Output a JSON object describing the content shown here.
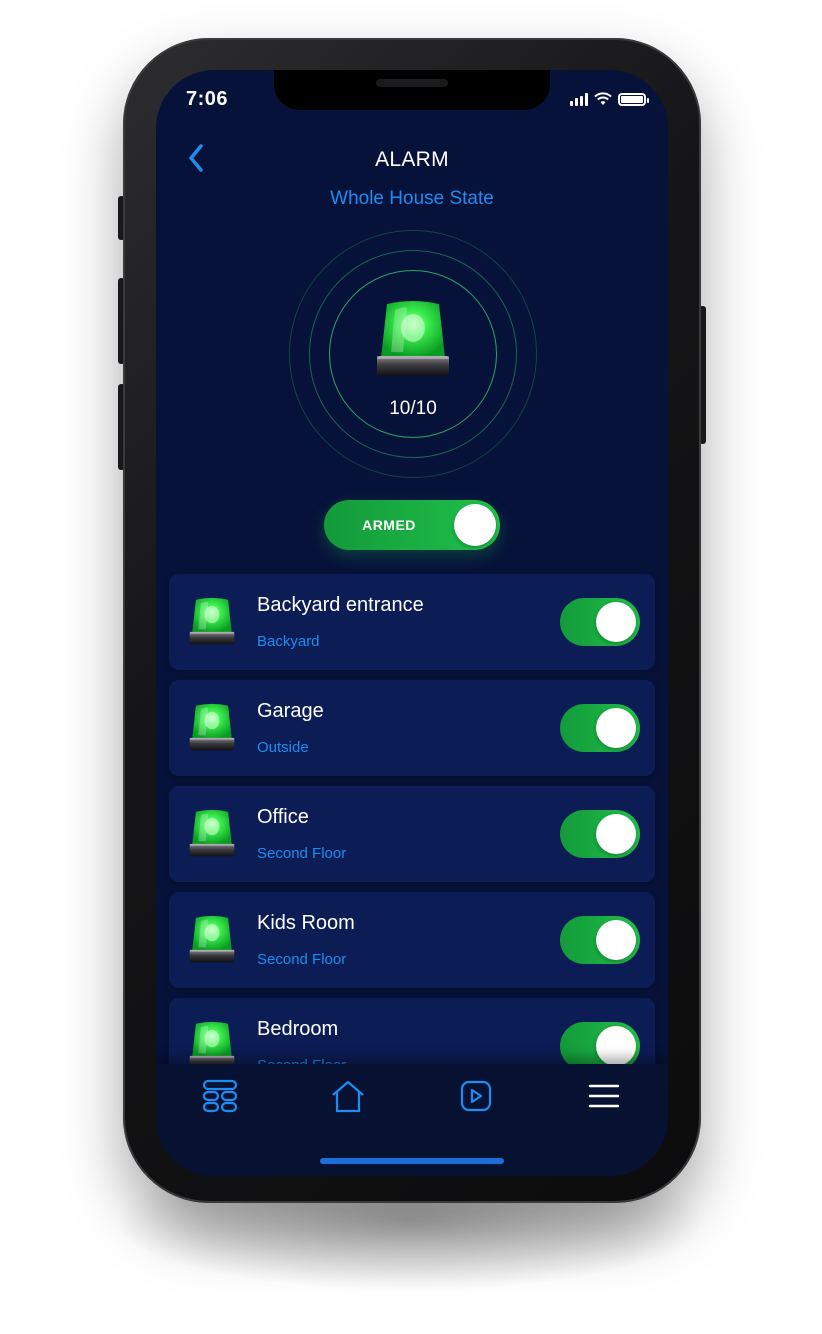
{
  "status_bar": {
    "time": "7:06"
  },
  "header": {
    "title": "ALARM",
    "subtitle": "Whole House State"
  },
  "summary": {
    "count_text": "10/10"
  },
  "armed_toggle": {
    "label": "ARMED",
    "on": true
  },
  "devices": [
    {
      "name": "Backyard entrance",
      "location": "Backyard",
      "on": true
    },
    {
      "name": "Garage",
      "location": "Outside",
      "on": true
    },
    {
      "name": "Office",
      "location": "Second Floor",
      "on": true
    },
    {
      "name": "Kids Room",
      "location": "Second Floor",
      "on": true
    },
    {
      "name": "Bedroom",
      "location": "Second Floor",
      "on": true
    }
  ],
  "tabs": [
    {
      "icon": "rooms-grid-icon"
    },
    {
      "icon": "home-icon"
    },
    {
      "icon": "play-icon"
    },
    {
      "icon": "menu-icon"
    }
  ],
  "colors": {
    "background": "#07123a",
    "card": "#0c1d56",
    "accent_blue": "#1e8cf0",
    "accent_green": "#1fc14a"
  }
}
